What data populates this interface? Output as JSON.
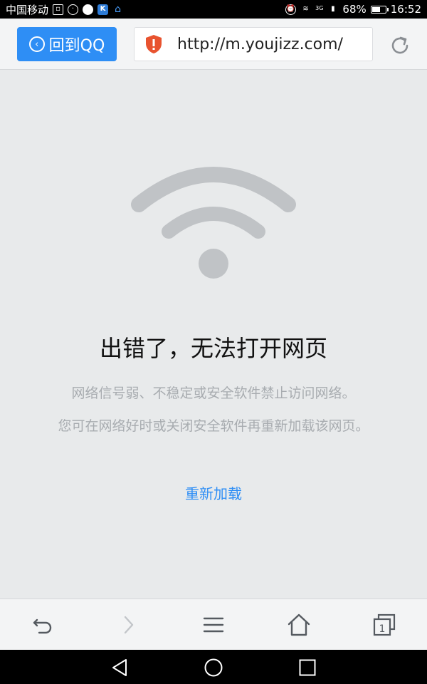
{
  "status_bar": {
    "carrier": "中国移动",
    "network": "3G",
    "battery": "68%",
    "battery_level": 0.68,
    "time": "16:52"
  },
  "toolbar": {
    "back_label": "回到QQ",
    "url": "http://m.youjizz.com/"
  },
  "error": {
    "title": "出错了，无法打开网页",
    "desc1": "网络信号弱、不稳定或安全软件禁止访问网络。",
    "desc2": "您可在网络好时或关闭安全软件再重新加载该网页。",
    "reload_label": "重新加载"
  },
  "bottom_nav": {
    "tab_count": "1"
  },
  "colors": {
    "accent": "#2e8ef5",
    "shield": "#e8532f",
    "icon_gray": "#c0c3c6"
  }
}
